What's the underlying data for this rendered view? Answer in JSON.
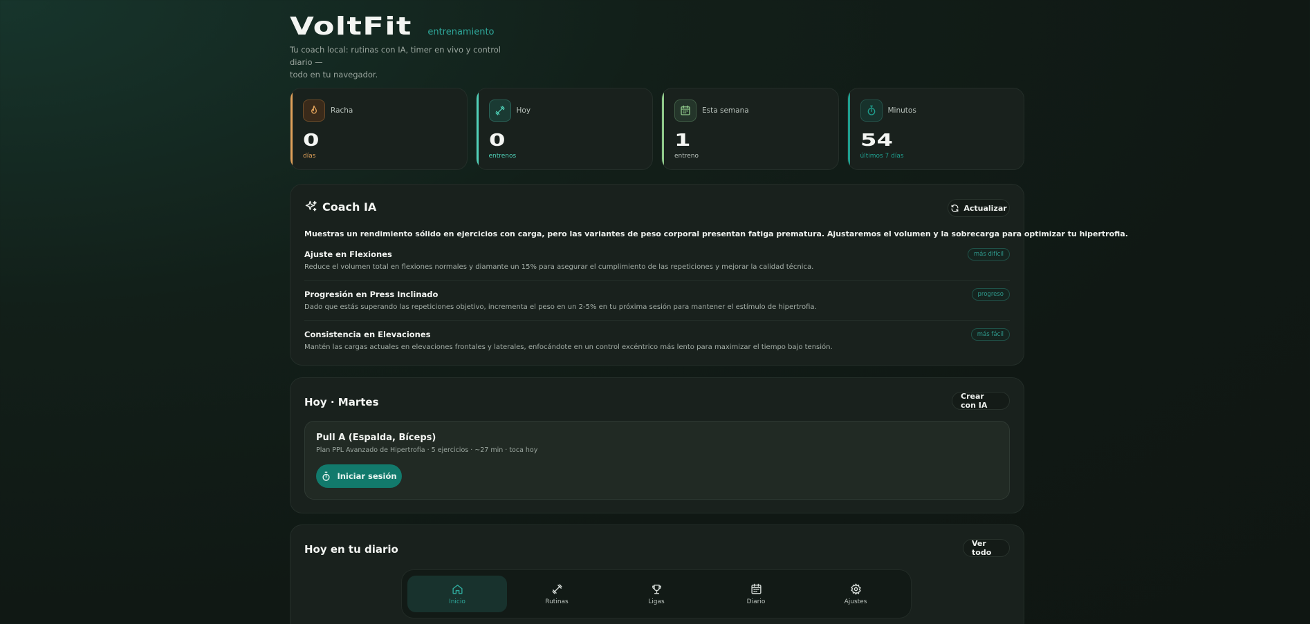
{
  "header": {
    "brand": "VoltFit",
    "subtitle": "entrenamiento",
    "tagline_line1": "Tu coach local: rutinas con IA, timer en vivo y control diario —",
    "tagline_line2": "todo en tu navegador."
  },
  "stats": [
    {
      "label": "Racha",
      "value": "0",
      "unit": "días",
      "icon": "flame-icon",
      "accent": "#e0a15a"
    },
    {
      "label": "Hoy",
      "value": "0",
      "unit": "entrenos",
      "icon": "dumbbell-icon",
      "accent": "#4fd1b8"
    },
    {
      "label": "Esta semana",
      "value": "1",
      "unit": "entreno",
      "icon": "calendar-icon",
      "accent": "#8fc98a"
    },
    {
      "label": "Minutos",
      "value": "54",
      "unit": "últimos 7 días",
      "icon": "stopwatch-icon",
      "accent": "#1f9f8f"
    }
  ],
  "coach": {
    "title": "Coach IA",
    "refresh_label": "Actualizar",
    "summary": "Muestras un rendimiento sólido en ejercicios con carga, pero las variantes de peso corporal presentan fatiga prematura. Ajustaremos el volumen y la sobrecarga para optimizar tu hipertrofia.",
    "tips": [
      {
        "title": "Ajuste en Flexiones",
        "desc": "Reduce el volumen total en flexiones normales y diamante un 15% para asegurar el cumplimiento de las repeticiones y mejorar la calidad técnica.",
        "tag": "más difícil"
      },
      {
        "title": "Progresión en Press Inclinado",
        "desc": "Dado que estás superando las repeticiones objetivo, incrementa el peso en un 2-5% en tu próxima sesión para mantener el estímulo de hipertrofia.",
        "tag": "progreso"
      },
      {
        "title": "Consistencia en Elevaciones",
        "desc": "Mantén las cargas actuales en elevaciones frontales y laterales, enfocándote en un control excéntrico más lento para maximizar el tiempo bajo tensión.",
        "tag": "más fácil"
      }
    ]
  },
  "today": {
    "title": "Hoy · Martes",
    "create_label": "Crear con IA",
    "session_title": "Pull A (Espalda, Bíceps)",
    "session_meta": "Plan PPL Avanzado de Hipertrofia · 5 ejercicios · ~27 min · toca hoy",
    "start_label": "Iniciar sesión"
  },
  "diary": {
    "title": "Hoy en tu diario",
    "see_all_label": "Ver todo"
  },
  "nav": [
    {
      "label": "Inicio",
      "icon": "home-icon",
      "active": true
    },
    {
      "label": "Rutinas",
      "icon": "dumbbell-icon",
      "active": false
    },
    {
      "label": "Ligas",
      "icon": "trophy-icon",
      "active": false
    },
    {
      "label": "Diario",
      "icon": "calendar-icon",
      "active": false
    },
    {
      "label": "Ajustes",
      "icon": "gear-icon",
      "active": false
    }
  ]
}
